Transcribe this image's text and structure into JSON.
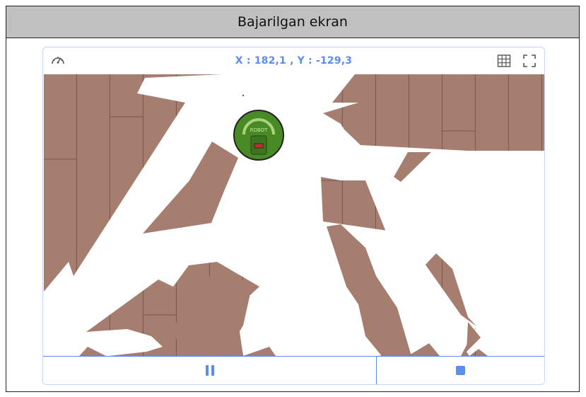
{
  "window": {
    "title": "Bajarilgan ekran"
  },
  "toolbar": {
    "coordinates": "X : 182,1 , Y : -129,3",
    "icons": [
      "speedometer-icon",
      "grid-icon",
      "fullscreen-icon"
    ]
  },
  "arena": {
    "floor": "wooden floor",
    "robot_label": "ROBOT"
  },
  "controls": {
    "pause_icon": "pause-icon",
    "stop_icon": "stop-icon"
  },
  "colors": {
    "accent": "#5b8def",
    "floor": "#a57e70",
    "robot": "#4a8a26",
    "header_bg": "#c0c0c0"
  }
}
